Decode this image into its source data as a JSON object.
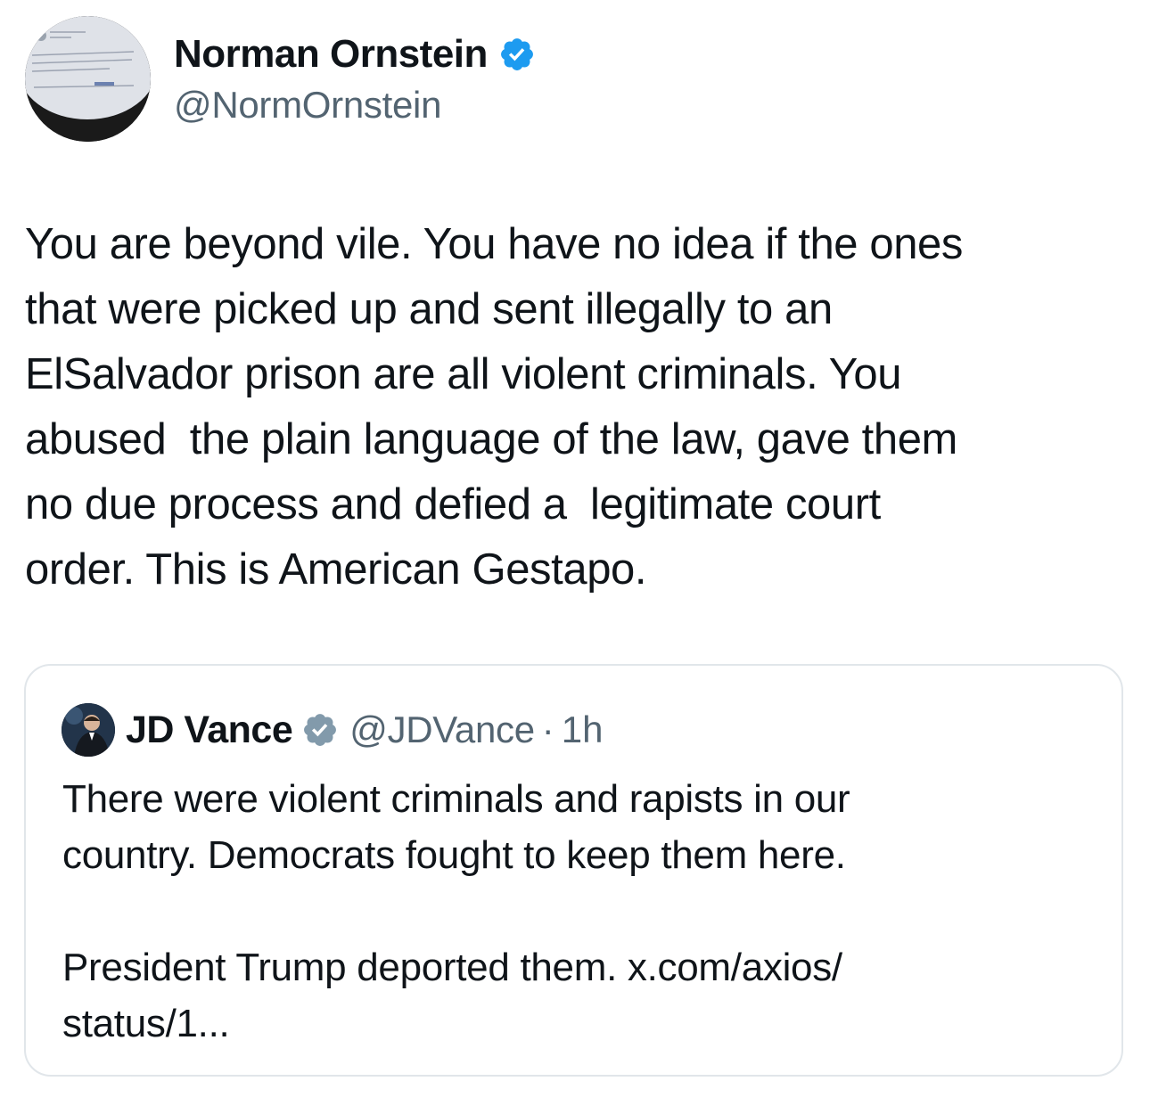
{
  "author": {
    "display_name": "Norman Ornstein",
    "handle": "@NormOrnstein",
    "verified": true,
    "avatar_icon": "avatar-photo-of-tweet-screenshot"
  },
  "tweet": {
    "text": "You are beyond vile. You have no idea if the ones\nthat were picked up and sent illegally to an\nElSalvador prison are all violent criminals. You\nabused  the plain language of the law, gave them\nno due process and defied a  legitimate court\norder. This is American Gestapo."
  },
  "quoted_tweet": {
    "display_name": "JD Vance",
    "handle": "@JDVance",
    "separator": "·",
    "time": "1h",
    "verified": true,
    "text_lines": [
      "There were violent criminals and rapists in our\ncountry. Democrats fought to keep them here.",
      "President Trump deported them. ",
      "x.com/axios/\nstatus/1..."
    ]
  },
  "colors": {
    "verified_blue": "#1d9bf0",
    "verified_gray": "#829aab",
    "text_primary": "#0f1419",
    "text_secondary": "#536471",
    "border": "#e1e6ea"
  }
}
